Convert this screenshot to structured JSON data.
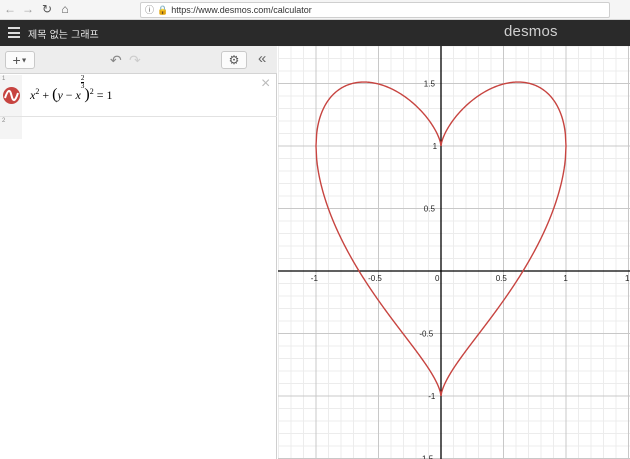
{
  "browser": {
    "back_icon": "arrow-left-icon",
    "forward_icon": "arrow-right-icon",
    "reload_icon": "reload-icon",
    "home_icon": "home-icon",
    "url": "https://www.desmos.com/calculator"
  },
  "header": {
    "title": "제목 없는 그래프",
    "brand": "desmos"
  },
  "toolbar": {
    "add_label": "+",
    "undo_icon": "undo-icon",
    "redo_icon": "redo-icon",
    "settings_icon": "wrench-icon",
    "collapse_icon": "double-chevron-left-icon"
  },
  "expressions": [
    {
      "number": "1",
      "latex": "x^2 + (y - x^(2/3))^2 = 1",
      "color": "#c74440"
    },
    {
      "number": "2",
      "latex": ""
    }
  ],
  "graph": {
    "x_ticks": [
      "-1",
      "-0.5",
      "0",
      "0.5",
      "1"
    ],
    "y_ticks": [
      "1.5",
      "1",
      "0.5",
      "-0.5",
      "-1",
      "-1.5"
    ],
    "curve_color": "#c74440",
    "axis_color": "#000000"
  }
}
